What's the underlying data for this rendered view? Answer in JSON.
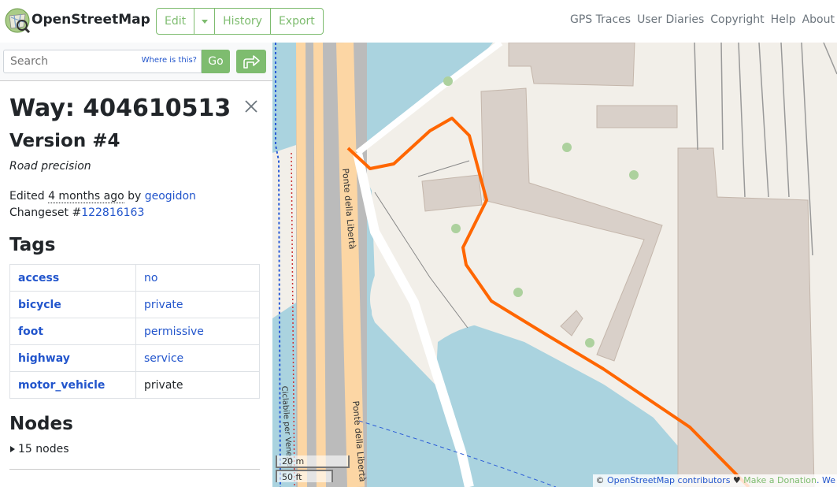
{
  "header": {
    "site_name": "OpenStreetMap",
    "edit_label": "Edit",
    "history_label": "History",
    "export_label": "Export",
    "nav": [
      "GPS Traces",
      "User Diaries",
      "Copyright",
      "Help",
      "About"
    ]
  },
  "search": {
    "placeholder": "Search",
    "where_label": "Where is this?",
    "go_label": "Go"
  },
  "way": {
    "title": "Way: 404610513",
    "version": "Version #4",
    "precision": "Road precision",
    "edited_prefix": "Edited",
    "edited_ago": "4 months ago",
    "edited_by": "by",
    "editor": "geogidon",
    "changeset_prefix": "Changeset #",
    "changeset": "122816163"
  },
  "tags": {
    "heading": "Tags",
    "rows": [
      {
        "key": "access",
        "value": "no",
        "link": true
      },
      {
        "key": "bicycle",
        "value": "private",
        "link": true
      },
      {
        "key": "foot",
        "value": "permissive",
        "link": true
      },
      {
        "key": "highway",
        "value": "service",
        "link": true
      },
      {
        "key": "motor_vehicle",
        "value": "private",
        "link": false
      }
    ]
  },
  "nodes": {
    "heading": "Nodes",
    "summary": "15 nodes"
  },
  "map": {
    "road_label": "Ponte della Libertà",
    "road_label_2": "Ponte della Libertà",
    "cycle_label": "Ciclabile per Venezia",
    "scale_m": "20 m",
    "scale_ft": "50 ft",
    "attrib_copy": "©",
    "attrib_link": "OpenStreetMap contributors",
    "attrib_heart": "♥",
    "attrib_donate": "Make a Donation",
    "attrib_more": ". We"
  },
  "colors": {
    "brand": "#7ebc6f",
    "link": "#2255cc",
    "water": "#aad3df",
    "highlight": "#ff6600",
    "road": "#fcd6a4",
    "building": "#d9d0c9"
  }
}
